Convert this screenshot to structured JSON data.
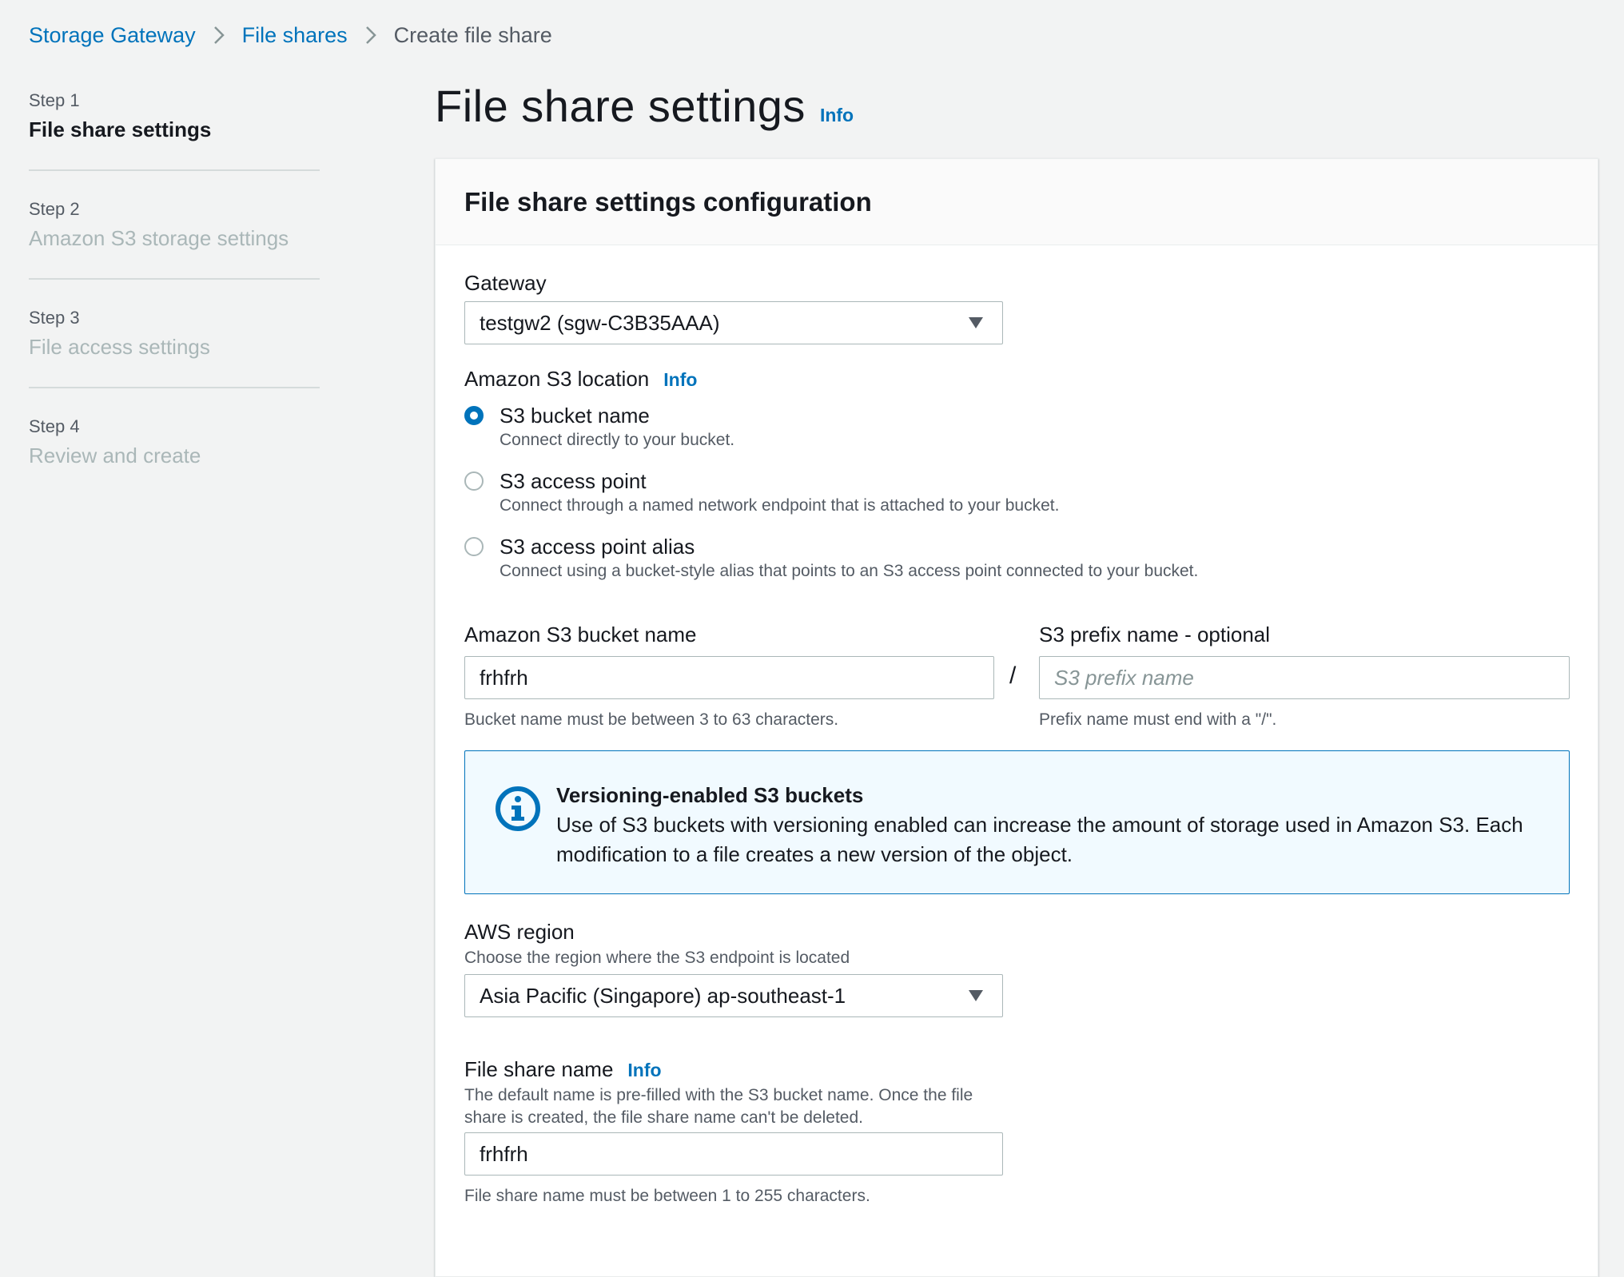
{
  "breadcrumb": {
    "items": [
      "Storage Gateway",
      "File shares"
    ],
    "current": "Create file share"
  },
  "steps": [
    {
      "num": "Step 1",
      "title": "File share settings"
    },
    {
      "num": "Step 2",
      "title": "Amazon S3 storage settings"
    },
    {
      "num": "Step 3",
      "title": "File access settings"
    },
    {
      "num": "Step 4",
      "title": "Review and create"
    }
  ],
  "page": {
    "title": "File share settings",
    "info": "Info"
  },
  "panel": {
    "title": "File share settings configuration",
    "gateway": {
      "label": "Gateway",
      "value": "testgw2 (sgw-C3B35AAA)"
    },
    "s3_location": {
      "label": "Amazon S3 location",
      "info": "Info",
      "options": [
        {
          "label": "S3 bucket name",
          "desc": "Connect directly to your bucket.",
          "checked": true
        },
        {
          "label": "S3 access point",
          "desc": "Connect through a named network endpoint that is attached to your bucket.",
          "checked": false
        },
        {
          "label": "S3 access point alias",
          "desc": "Connect using a bucket-style alias that points to an S3 access point connected to your bucket.",
          "checked": false
        }
      ]
    },
    "bucket": {
      "label": "Amazon S3 bucket name",
      "value": "frhfrh",
      "constraint": "Bucket name must be between 3 to 63 characters."
    },
    "separator": "/",
    "prefix": {
      "label": "S3 prefix name - optional",
      "placeholder": "S3 prefix name",
      "value": "",
      "constraint": "Prefix name must end with a \"/\"."
    },
    "alert": {
      "title": "Versioning-enabled S3 buckets",
      "text": "Use of S3 buckets with versioning enabled can increase the amount of storage used in Amazon S3. Each modification to a file creates a new version of the object."
    },
    "region": {
      "label": "AWS region",
      "desc": "Choose the region where the S3 endpoint is located",
      "value": "Asia Pacific (Singapore) ap-southeast-1"
    },
    "share_name": {
      "label": "File share name",
      "info": "Info",
      "desc": "The default name is pre-filled with the S3 bucket name. Once the file share is created, the file share name can't be deleted.",
      "value": "frhfrh",
      "constraint": "File share name must be between 1 to 255 characters."
    }
  },
  "colors": {
    "link": "#0073bb",
    "background": "#f2f3f3",
    "alert_bg": "#f1faff"
  }
}
